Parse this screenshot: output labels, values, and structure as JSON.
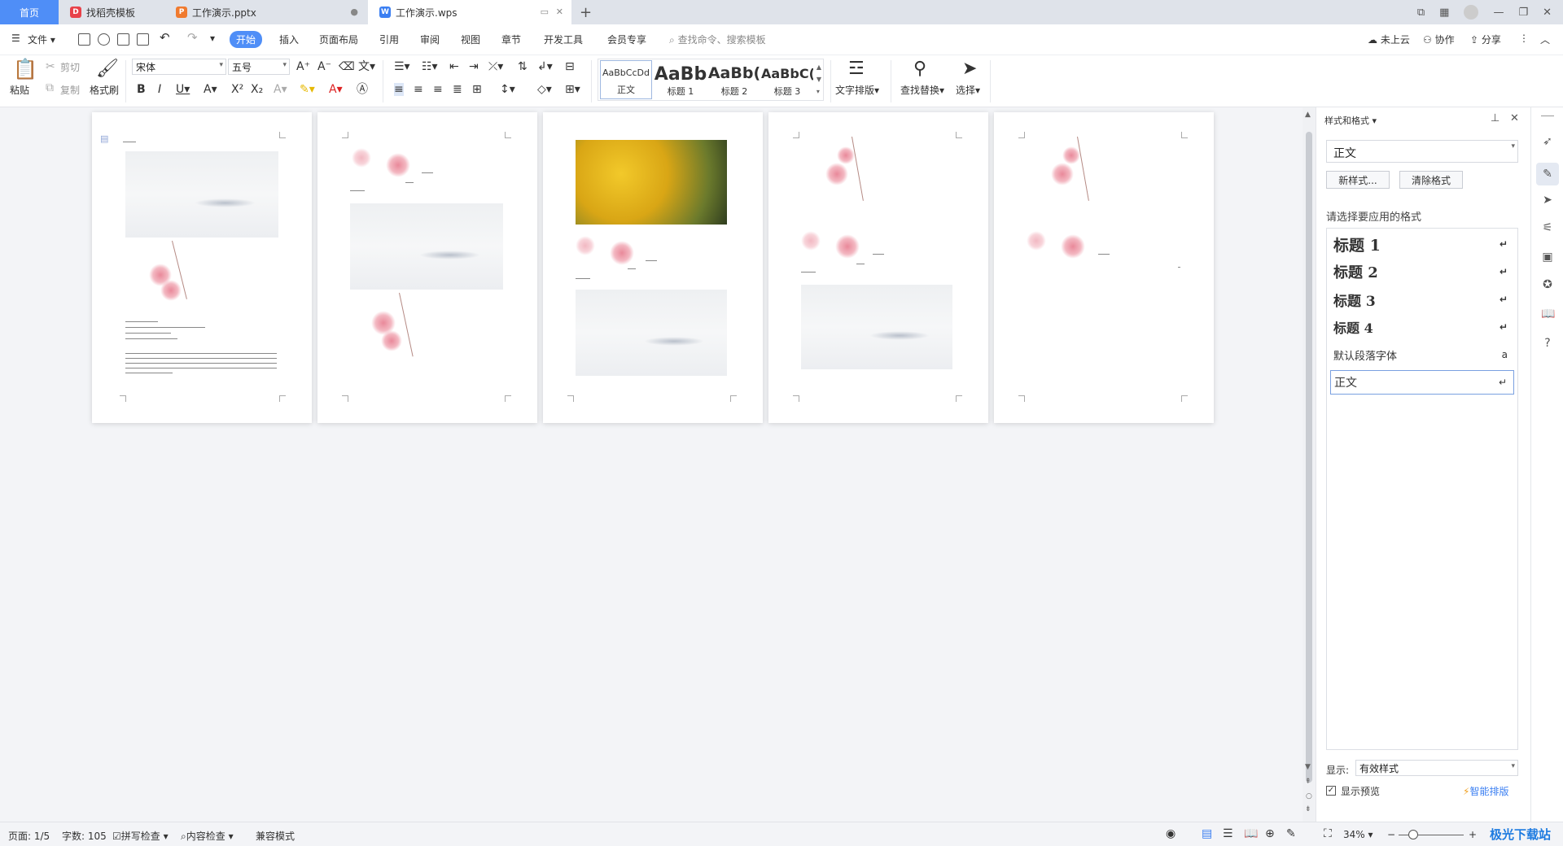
{
  "tabs": [
    {
      "label": "首页"
    },
    {
      "label": "找稻壳模板"
    },
    {
      "label": "工作演示.pptx"
    },
    {
      "label": "工作演示.wps"
    }
  ],
  "menu": {
    "file": "文件",
    "items": [
      "开始",
      "插入",
      "页面布局",
      "引用",
      "审阅",
      "视图",
      "章节",
      "开发工具",
      "会员专享"
    ],
    "search_placeholder": "查找命令、搜索模板",
    "cloud": "未上云",
    "collab": "协作",
    "share": "分享"
  },
  "ribbon": {
    "paste": "粘贴",
    "cut": "剪切",
    "copy": "复制",
    "format_painter": "格式刷",
    "font": "宋体",
    "size": "五号",
    "styles": [
      {
        "sample": "AaBbCcDd",
        "label": "正文"
      },
      {
        "sample": "AaBb",
        "label": "标题 1"
      },
      {
        "sample": "AaBb(",
        "label": "标题 2"
      },
      {
        "sample": "AaBbC(",
        "label": "标题 3"
      }
    ],
    "text_layout": "文字排版",
    "find_replace": "查找替换",
    "select": "选择"
  },
  "panel": {
    "title": "样式和格式",
    "current_style": "正文",
    "new_style": "新样式...",
    "clear_format": "清除格式",
    "prompt": "请选择要应用的格式",
    "styles": [
      "标题 1",
      "标题 2",
      "标题 3",
      "标题 4",
      "默认段落字体",
      "正文"
    ],
    "show_label": "显示:",
    "show_value": "有效样式",
    "preview": "显示预览",
    "smart": "智能排版"
  },
  "status": {
    "page": "页面: 1/5",
    "words": "字数: 105",
    "spell": "拼写检查",
    "content": "内容检查",
    "compat": "兼容模式",
    "zoom": "34%"
  },
  "watermark": "极光下载站"
}
